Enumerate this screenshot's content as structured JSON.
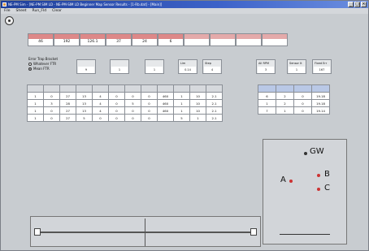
{
  "titlebar": {
    "title": "NE-PM Sim - [NE-PM SIM LD - NE-PM-SIM LD Beginner Map Sensor Results - [1-Rb.dat] - [Main]]"
  },
  "menu": {
    "items": [
      "File",
      "Sheet",
      "Run_Fld",
      "Clear"
    ]
  },
  "top_values": [
    "46",
    "192",
    "126.1",
    "37",
    "24",
    "6",
    "",
    "",
    "",
    ""
  ],
  "radio_group": {
    "label": "Error Trap Bracket",
    "options": [
      "Whatever FTR",
      "Mean FTR"
    ],
    "selected": 1
  },
  "spinboxes": [
    {
      "label": "",
      "value": "9"
    },
    {
      "label": "",
      "value": "1"
    },
    {
      "label": "",
      "value": "1"
    },
    {
      "label": "Lim",
      "value": "0.14"
    },
    {
      "label": "Step",
      "value": "4"
    },
    {
      "label": "All RPM",
      "value": "3"
    },
    {
      "label": "Sensor It",
      "value": "1"
    },
    {
      "label": "Fixed Err",
      "value": "167"
    }
  ],
  "grid_rows": [
    [
      "1",
      "0",
      "27",
      "13",
      "4",
      "0",
      "0",
      "0",
      "460",
      "1",
      "10",
      "2.1"
    ],
    [
      "1",
      "3",
      "28",
      "13",
      "4",
      "0",
      "5",
      "0",
      "460",
      "1",
      "10",
      "2.1"
    ],
    [
      "1",
      "0",
      "27",
      "13",
      "4",
      "0",
      "0",
      "0",
      "460",
      "1",
      "10",
      "2.1"
    ],
    [
      "1",
      "0",
      "27",
      "5",
      "0",
      "0",
      "0",
      "0",
      "",
      "5",
      "1",
      "2.1"
    ]
  ],
  "grid2_rows": [
    [
      "6",
      "2",
      "0",
      "19.18"
    ],
    [
      "1",
      "2",
      "0",
      "19.18"
    ],
    [
      "7",
      "1",
      "0",
      "19.14"
    ]
  ],
  "diagram": {
    "labels": [
      "GW",
      "A",
      "B",
      "C"
    ]
  }
}
